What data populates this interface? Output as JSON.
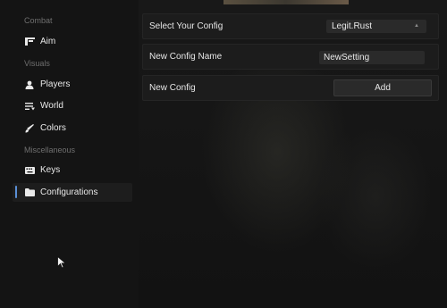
{
  "sidebar": {
    "sections": [
      {
        "title": "Combat"
      },
      {
        "title": "Visuals"
      },
      {
        "title": "Miscellaneous"
      }
    ],
    "items": [
      {
        "label": "Aim",
        "icon": "aim-icon"
      },
      {
        "label": "Players",
        "icon": "person-icon"
      },
      {
        "label": "World",
        "icon": "world-icon"
      },
      {
        "label": "Colors",
        "icon": "brush-icon"
      },
      {
        "label": "Keys",
        "icon": "keyboard-icon"
      },
      {
        "label": "Configurations",
        "icon": "folder-icon",
        "active": true
      }
    ]
  },
  "config": {
    "select_label": "Select Your Config",
    "select_value": "Legit.Rust",
    "name_label": "New Config Name",
    "name_value": "NewSetting",
    "new_label": "New Config",
    "add_button": "Add"
  },
  "colors": {
    "accent": "#5a8fd6",
    "background": "#131313",
    "panel": "#1c1c1c",
    "control": "#2a2a2a"
  }
}
